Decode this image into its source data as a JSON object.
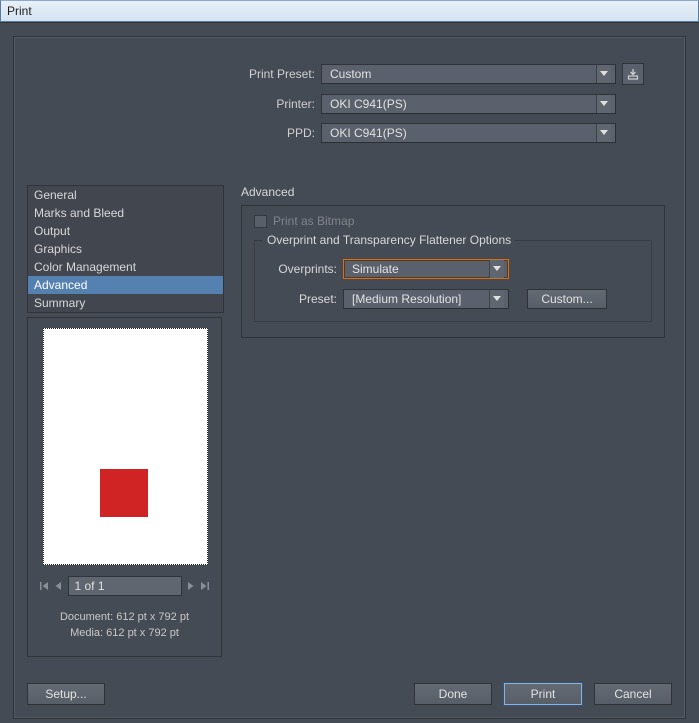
{
  "window": {
    "title": "Print"
  },
  "top_fields": {
    "print_preset_label": "Print Preset:",
    "print_preset_value": "Custom",
    "printer_label": "Printer:",
    "printer_value": "OKI C941(PS)",
    "ppd_label": "PPD:",
    "ppd_value": "OKI C941(PS)"
  },
  "sidebar": {
    "items": [
      {
        "label": "General"
      },
      {
        "label": "Marks and Bleed"
      },
      {
        "label": "Output"
      },
      {
        "label": "Graphics"
      },
      {
        "label": "Color Management"
      },
      {
        "label": "Advanced",
        "selected": true
      },
      {
        "label": "Summary"
      }
    ]
  },
  "advanced": {
    "title": "Advanced",
    "print_as_bitmap": "Print as Bitmap",
    "group_title": "Overprint and Transparency Flattener Options",
    "overprints_label": "Overprints:",
    "overprints_value": "Simulate",
    "preset_label": "Preset:",
    "preset_value": "[Medium Resolution]",
    "custom_button": "Custom..."
  },
  "preview": {
    "page_indicator": "1 of 1",
    "document_label": "Document:",
    "document_value": "612 pt x 792 pt",
    "media_label": "Media:",
    "media_value": "612 pt x 792 pt"
  },
  "buttons": {
    "setup": "Setup...",
    "done": "Done",
    "print": "Print",
    "cancel": "Cancel"
  }
}
